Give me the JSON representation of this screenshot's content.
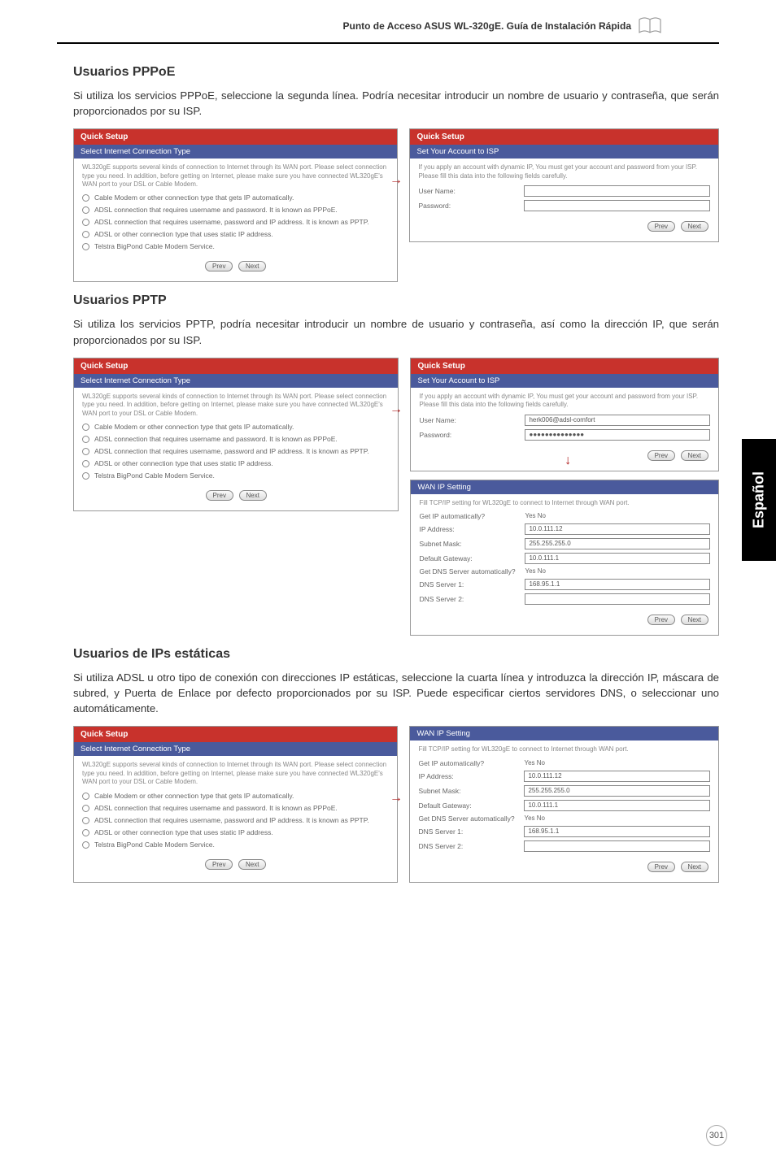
{
  "header": {
    "title": "Punto de Acceso ASUS WL-320gE. Guía de Instalación Rápida"
  },
  "side_tab": "Español",
  "page_number": "301",
  "sections": {
    "pppoe": {
      "heading": "Usuarios PPPoE",
      "para": "Si utiliza los servicios PPPoE, seleccione la segunda línea. Podría necesitar introducir un nombre de usuario y contraseña, que serán proporcionados por su ISP.",
      "left": {
        "title": "Quick Setup",
        "subtitle": "Select Internet Connection Type",
        "intro": "WL320gE supports several kinds of connection to Internet through its WAN port. Please select connection type you need. In addition, before getting on Internet, please make sure you have connected WL320gE's WAN port to your DSL or Cable Modem.",
        "opts": [
          "Cable Modem or other connection type that gets IP automatically.",
          "ADSL connection that requires username and password. It is known as PPPoE.",
          "ADSL connection that requires username, password and IP address. It is known as PPTP.",
          "ADSL or other connection type that uses static IP address.",
          "Telstra BigPond Cable Modem Service."
        ],
        "btn_prev": "Prev",
        "btn_next": "Next"
      },
      "right": {
        "title": "Quick Setup",
        "subtitle": "Set Your Account to ISP",
        "intro": "If you apply an account with dynamic IP, You must get your account and password from your ISP. Please fill this data into the following fields carefully.",
        "user_label": "User Name:",
        "pass_label": "Password:",
        "btn_prev": "Prev",
        "btn_next": "Next"
      }
    },
    "pptp": {
      "heading": "Usuarios PPTP",
      "para": "Si utiliza los servicios PPTP, podría necesitar introducir un nombre de usuario y contraseña, así como la dirección IP, que serán proporcionados por su ISP.",
      "left": {
        "title": "Quick Setup",
        "subtitle": "Select Internet Connection Type",
        "intro": "WL320gE supports several kinds of connection to Internet through its WAN port. Please select connection type you need. In addition, before getting on Internet, please make sure you have connected WL320gE's WAN port to your DSL or Cable Modem.",
        "opts": [
          "Cable Modem or other connection type that gets IP automatically.",
          "ADSL connection that requires username and password. It is known as PPPoE.",
          "ADSL connection that requires username, password and IP address. It is known as PPTP.",
          "ADSL or other connection type that uses static IP address.",
          "Telstra BigPond Cable Modem Service."
        ],
        "btn_prev": "Prev",
        "btn_next": "Next"
      },
      "right_top": {
        "title": "Quick Setup",
        "subtitle": "Set Your Account to ISP",
        "intro": "If you apply an account with dynamic IP, You must get your account and password from your ISP. Please fill this data into the following fields carefully.",
        "user_label": "User Name:",
        "pass_label": "Password:",
        "user_val": "herk006@adsl-comfort",
        "pass_val": "●●●●●●●●●●●●●●",
        "btn_prev": "Prev",
        "btn_next": "Next"
      },
      "right_bot": {
        "title": "WAN IP Setting",
        "intro": "Fill TCP/IP setting for WL320gE to connect to Internet through WAN port.",
        "rows": {
          "auto": {
            "label": "Get IP automatically?",
            "val": "Yes  No"
          },
          "ip": {
            "label": "IP Address:",
            "val": "10.0.111.12"
          },
          "mask": {
            "label": "Subnet Mask:",
            "val": "255.255.255.0"
          },
          "gw": {
            "label": "Default Gateway:",
            "val": "10.0.111.1"
          },
          "dns_auto": {
            "label": "Get DNS Server automatically?",
            "val": "Yes  No"
          },
          "dns1": {
            "label": "DNS Server 1:",
            "val": "168.95.1.1"
          },
          "dns2": {
            "label": "DNS Server 2:",
            "val": ""
          }
        },
        "btn_prev": "Prev",
        "btn_next": "Next"
      }
    },
    "static": {
      "heading": "Usuarios de IPs estáticas",
      "para": "Si utiliza ADSL u otro tipo de conexión con direcciones IP estáticas, seleccione la cuarta línea y introduzca la dirección IP, máscara de subred, y Puerta de Enlace por defecto proporcionados por su ISP. Puede especificar ciertos servidores DNS, o seleccionar uno automáticamente.",
      "left": {
        "title": "Quick Setup",
        "subtitle": "Select Internet Connection Type",
        "intro": "WL320gE supports several kinds of connection to Internet through its WAN port. Please select connection type you need. In addition, before getting on Internet, please make sure you have connected WL320gE's WAN port to your DSL or Cable Modem.",
        "opts": [
          "Cable Modem or other connection type that gets IP automatically.",
          "ADSL connection that requires username and password. It is known as PPPoE.",
          "ADSL connection that requires username, password and IP address. It is known as PPTP.",
          "ADSL or other connection type that uses static IP address.",
          "Telstra BigPond Cable Modem Service."
        ],
        "btn_prev": "Prev",
        "btn_next": "Next"
      },
      "right": {
        "title": "WAN IP Setting",
        "intro": "Fill TCP/IP setting for WL320gE to connect to Internet through WAN port.",
        "rows": {
          "auto": {
            "label": "Get IP automatically?",
            "val": "Yes  No"
          },
          "ip": {
            "label": "IP Address:",
            "val": "10.0.111.12"
          },
          "mask": {
            "label": "Subnet Mask:",
            "val": "255.255.255.0"
          },
          "gw": {
            "label": "Default Gateway:",
            "val": "10.0.111.1"
          },
          "dns_auto": {
            "label": "Get DNS Server automatically?",
            "val": "Yes  No"
          },
          "dns1": {
            "label": "DNS Server 1:",
            "val": "168.95.1.1"
          },
          "dns2": {
            "label": "DNS Server 2:",
            "val": ""
          }
        },
        "btn_prev": "Prev",
        "btn_next": "Next"
      }
    }
  }
}
